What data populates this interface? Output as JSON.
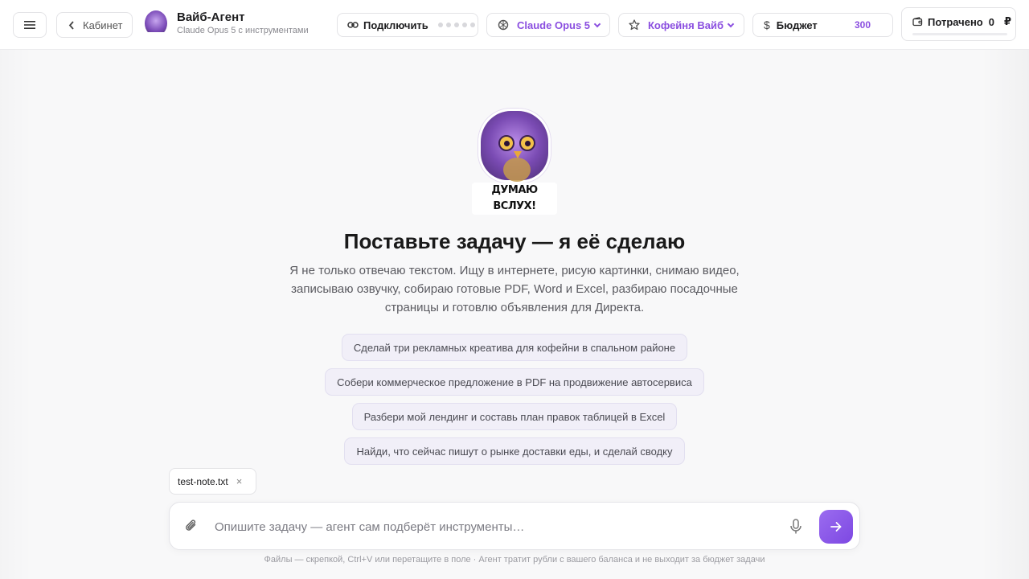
{
  "header": {
    "back_label": "Кабинет",
    "brand_title": "Вайб-Агент",
    "brand_subtitle": "Claude Opus 5 с инструментами",
    "connect_label": "Подключить",
    "model_label": "Claude Opus 5",
    "vibe_label": "Кофейня Вайб",
    "budget_label": "Бюджет",
    "budget_value": "300",
    "spent_label": "Потрачено",
    "spent_value": "0",
    "currency_symbol": "₽",
    "spent_fraction": 0
  },
  "mascot": {
    "caption": "ДУМАЮ ВСЛУХ!"
  },
  "main": {
    "headline": "Поставьте задачу — я её сделаю",
    "description": "Я не только отвечаю текстом. Ищу в интернете, рисую картинки, снимаю видео, записываю озвучку, собираю готовые PDF, Word и Excel, разбираю посадочные страницы и готовлю объявления для Директа.",
    "suggestions": [
      "Сделай три рекламных креатива для кофейни в спальном районе",
      "Собери коммерческое предложение в PDF на продвижение автосервиса",
      "Разбери мой лендинг и составь план правок таблицей в Excel",
      "Найди, что сейчас пишут о рынке доставки еды, и сделай сводку"
    ]
  },
  "attachment": {
    "file_name": "test-note.txt",
    "remove_symbol": "×"
  },
  "composer": {
    "value": "",
    "placeholder": "Опишите задачу — агент сам подберёт инструменты…"
  },
  "footer": {
    "note": "Файлы — скрепкой, Ctrl+V или перетащите в поле · Агент тратит рубли с вашего баланса и не выходит за бюджет задачи"
  },
  "icons": {
    "menu": "menu-icon",
    "back": "chevron-left-icon",
    "link": "link-icon",
    "model": "model-icon",
    "star": "star-icon",
    "dollar": "dollar-icon",
    "wallet": "wallet-icon",
    "paperclip": "paperclip-icon",
    "mic": "mic-icon",
    "send": "arrow-right-icon"
  },
  "colors": {
    "accent": "#8b4fe0",
    "send_button": "#8b5cf0"
  }
}
